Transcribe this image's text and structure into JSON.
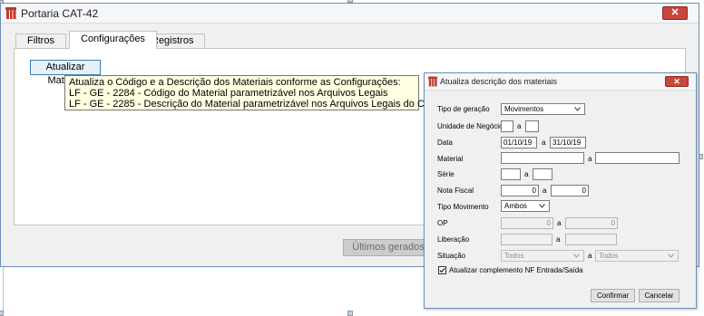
{
  "window": {
    "title": "Portaria CAT-42",
    "close_glyph": "✕",
    "tabs": [
      {
        "label": "Filtros",
        "active": false
      },
      {
        "label": "Configurações",
        "active": true
      },
      {
        "label": "Registros",
        "active": false
      }
    ]
  },
  "configuracoes": {
    "update_button": "Atualizar Material",
    "tooltip_lines": [
      "Atualiza o Código e a Descrição dos Materiais conforme as Configurações:",
      "LF - GE - 2284 - Código do Material parametrizável nos Arquivos Legais",
      "LF - GE - 2285 - Descrição do Material parametrizável nos Arquivos Legais do CIGAM."
    ],
    "last_generated_button": "Últimos gerados"
  },
  "dialog": {
    "title": "Atualiza descrição dos materiais",
    "close_glyph": "✕",
    "fields": {
      "tipo_geracao": {
        "label": "Tipo de geração",
        "value": "Movimentos"
      },
      "unidade_negocio": {
        "label": "Unidade de Negócio",
        "from": "",
        "sep": "a",
        "to": ""
      },
      "data": {
        "label": "Data",
        "from": "01/10/19",
        "sep": "a",
        "to": "31/10/19"
      },
      "material": {
        "label": "Material",
        "from": "",
        "sep": "a",
        "to": ""
      },
      "serie": {
        "label": "Série",
        "from": "",
        "sep": "a",
        "to": ""
      },
      "nota_fiscal": {
        "label": "Nota Fiscal",
        "from": "0",
        "sep": "a",
        "to": "0"
      },
      "tipo_movimento": {
        "label": "Tipo Movimento",
        "value": "Ambos"
      },
      "op": {
        "label": "OP",
        "from": "0",
        "sep": "a",
        "to": "0"
      },
      "liberacao": {
        "label": "Liberação",
        "from": "",
        "sep": "a",
        "to": ""
      },
      "situacao": {
        "label": "Situação",
        "from": "Todos",
        "sep": "a",
        "to": "Todos"
      }
    },
    "checkbox": {
      "label": "Atualizar complemento NF Entrada/Saída",
      "checked": true,
      "mark": "✓"
    },
    "buttons": {
      "confirm": "Confirmar",
      "cancel": "Cancelar"
    }
  },
  "colors": {
    "app_icon": "#c0392b",
    "close_button": "#c8463a",
    "tooltip_bg": "#ffffe1",
    "focus_border": "#3c7fb1"
  }
}
